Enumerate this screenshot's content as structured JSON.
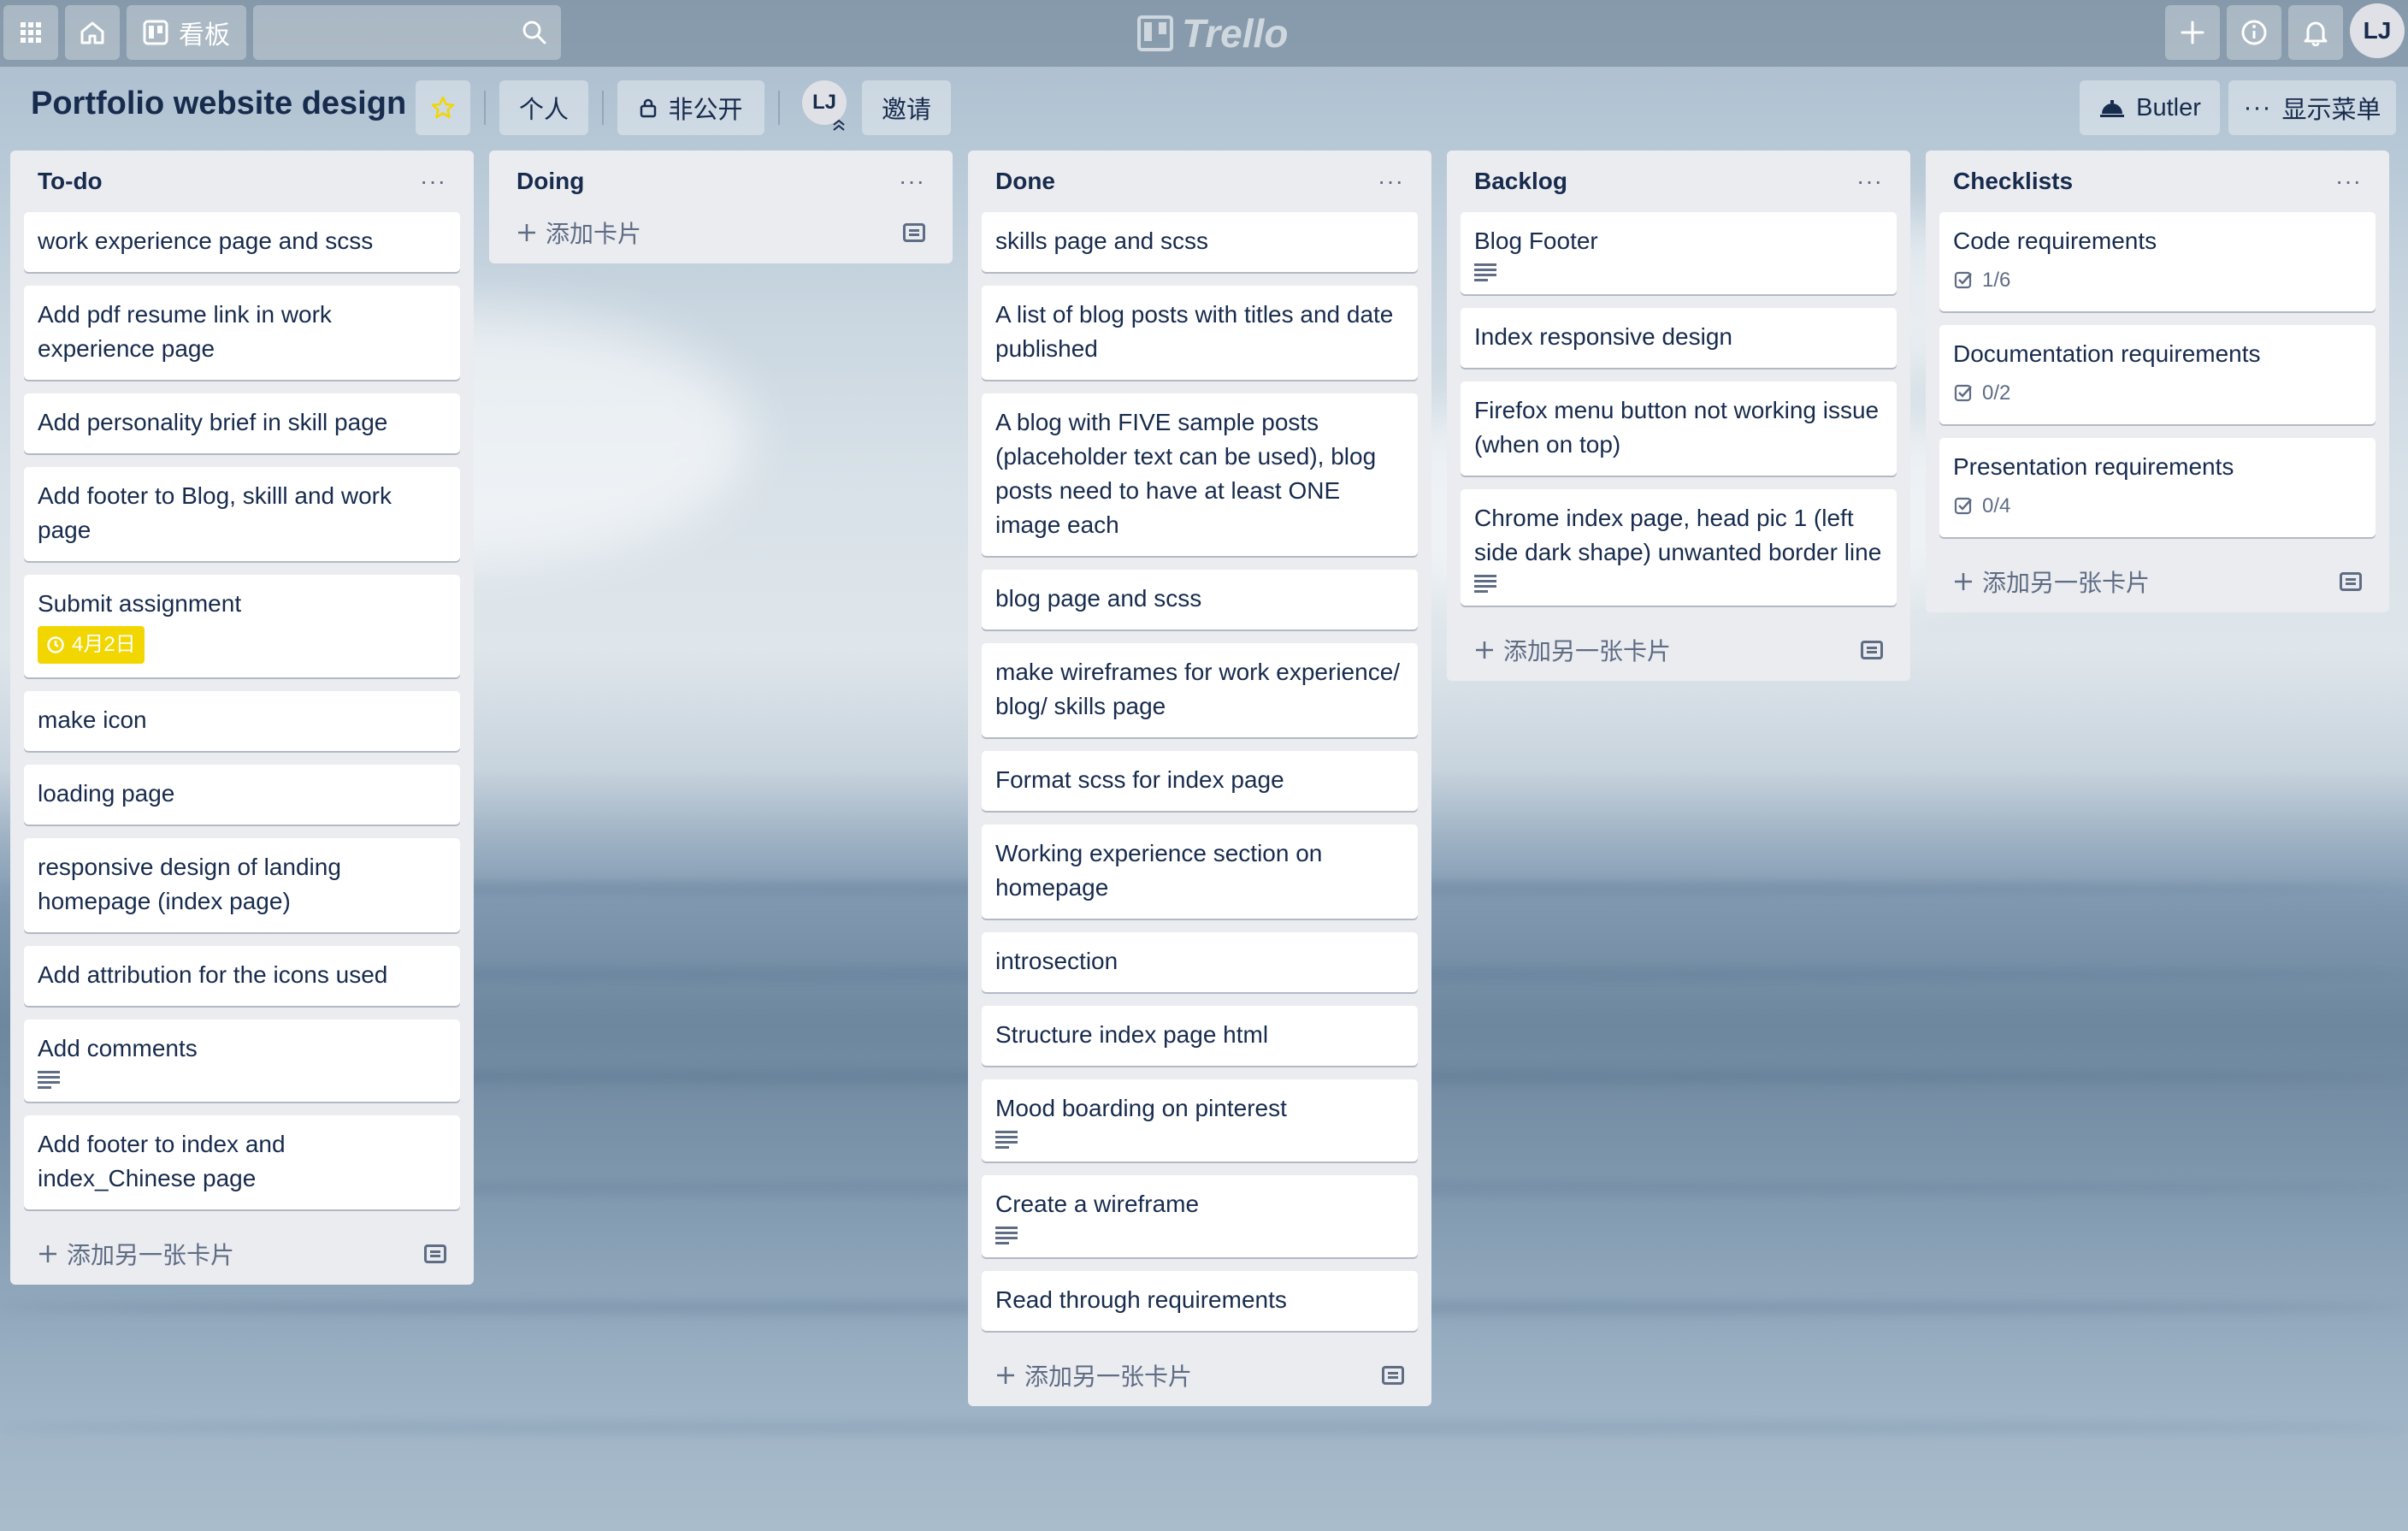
{
  "nav": {
    "boards_label": "看板",
    "logo_text": "Trello",
    "user_initials": "LJ"
  },
  "header": {
    "title": "Portfolio website design",
    "personal_label": "个人",
    "privacy_label": "非公开",
    "member_initials": "LJ",
    "invite_label": "邀请",
    "butler_label": "Butler",
    "menu_label": "显示菜单"
  },
  "lists": [
    {
      "title": "To-do",
      "add_label": "添加另一张卡片",
      "cards": [
        {
          "title": "work experience page and scss"
        },
        {
          "title": "Add pdf resume link in work experience page"
        },
        {
          "title": "Add personality brief in skill page"
        },
        {
          "title": "Add footer to Blog, skilll and work page"
        },
        {
          "title": "Submit assignment",
          "due": "4月2日"
        },
        {
          "title": "make icon"
        },
        {
          "title": "loading page"
        },
        {
          "title": "responsive design of landing homepage (index page)"
        },
        {
          "title": "Add attribution for the icons used"
        },
        {
          "title": "Add comments",
          "description": true
        },
        {
          "title": "Add footer to index and index_Chinese page"
        }
      ]
    },
    {
      "title": "Doing",
      "add_label": "添加卡片",
      "cards": []
    },
    {
      "title": "Done",
      "add_label": "添加另一张卡片",
      "cards": [
        {
          "title": "skills page and scss"
        },
        {
          "title": "A list of blog posts with titles and date published"
        },
        {
          "title": "A blog with FIVE sample posts (placeholder text can be used), blog posts need to have at least ONE image each"
        },
        {
          "title": "blog page and scss"
        },
        {
          "title": "make wireframes for work experience/ blog/ skills page"
        },
        {
          "title": "Format scss for index page"
        },
        {
          "title": "Working experience section on homepage"
        },
        {
          "title": "introsection"
        },
        {
          "title": "Structure index page html"
        },
        {
          "title": "Mood boarding on pinterest",
          "description": true
        },
        {
          "title": "Create a wireframe",
          "description": true
        },
        {
          "title": "Read through requirements"
        }
      ]
    },
    {
      "title": "Backlog",
      "add_label": "添加另一张卡片",
      "cards": [
        {
          "title": "Blog Footer",
          "description": true
        },
        {
          "title": "Index responsive design"
        },
        {
          "title": "Firefox menu button not working issue (when on top)"
        },
        {
          "title": "Chrome index page, head pic 1 (left side dark shape) unwanted border line",
          "description": true
        }
      ]
    },
    {
      "title": "Checklists",
      "add_label": "添加另一张卡片",
      "cards": [
        {
          "title": "Code requirements",
          "checklist": "1/6"
        },
        {
          "title": "Documentation requirements",
          "checklist": "0/2"
        },
        {
          "title": "Presentation requirements",
          "checklist": "0/4"
        }
      ]
    }
  ],
  "colors": {
    "list_bg": "#ebecf0",
    "due_badge": "#f2d600",
    "text": "#172b4d"
  }
}
